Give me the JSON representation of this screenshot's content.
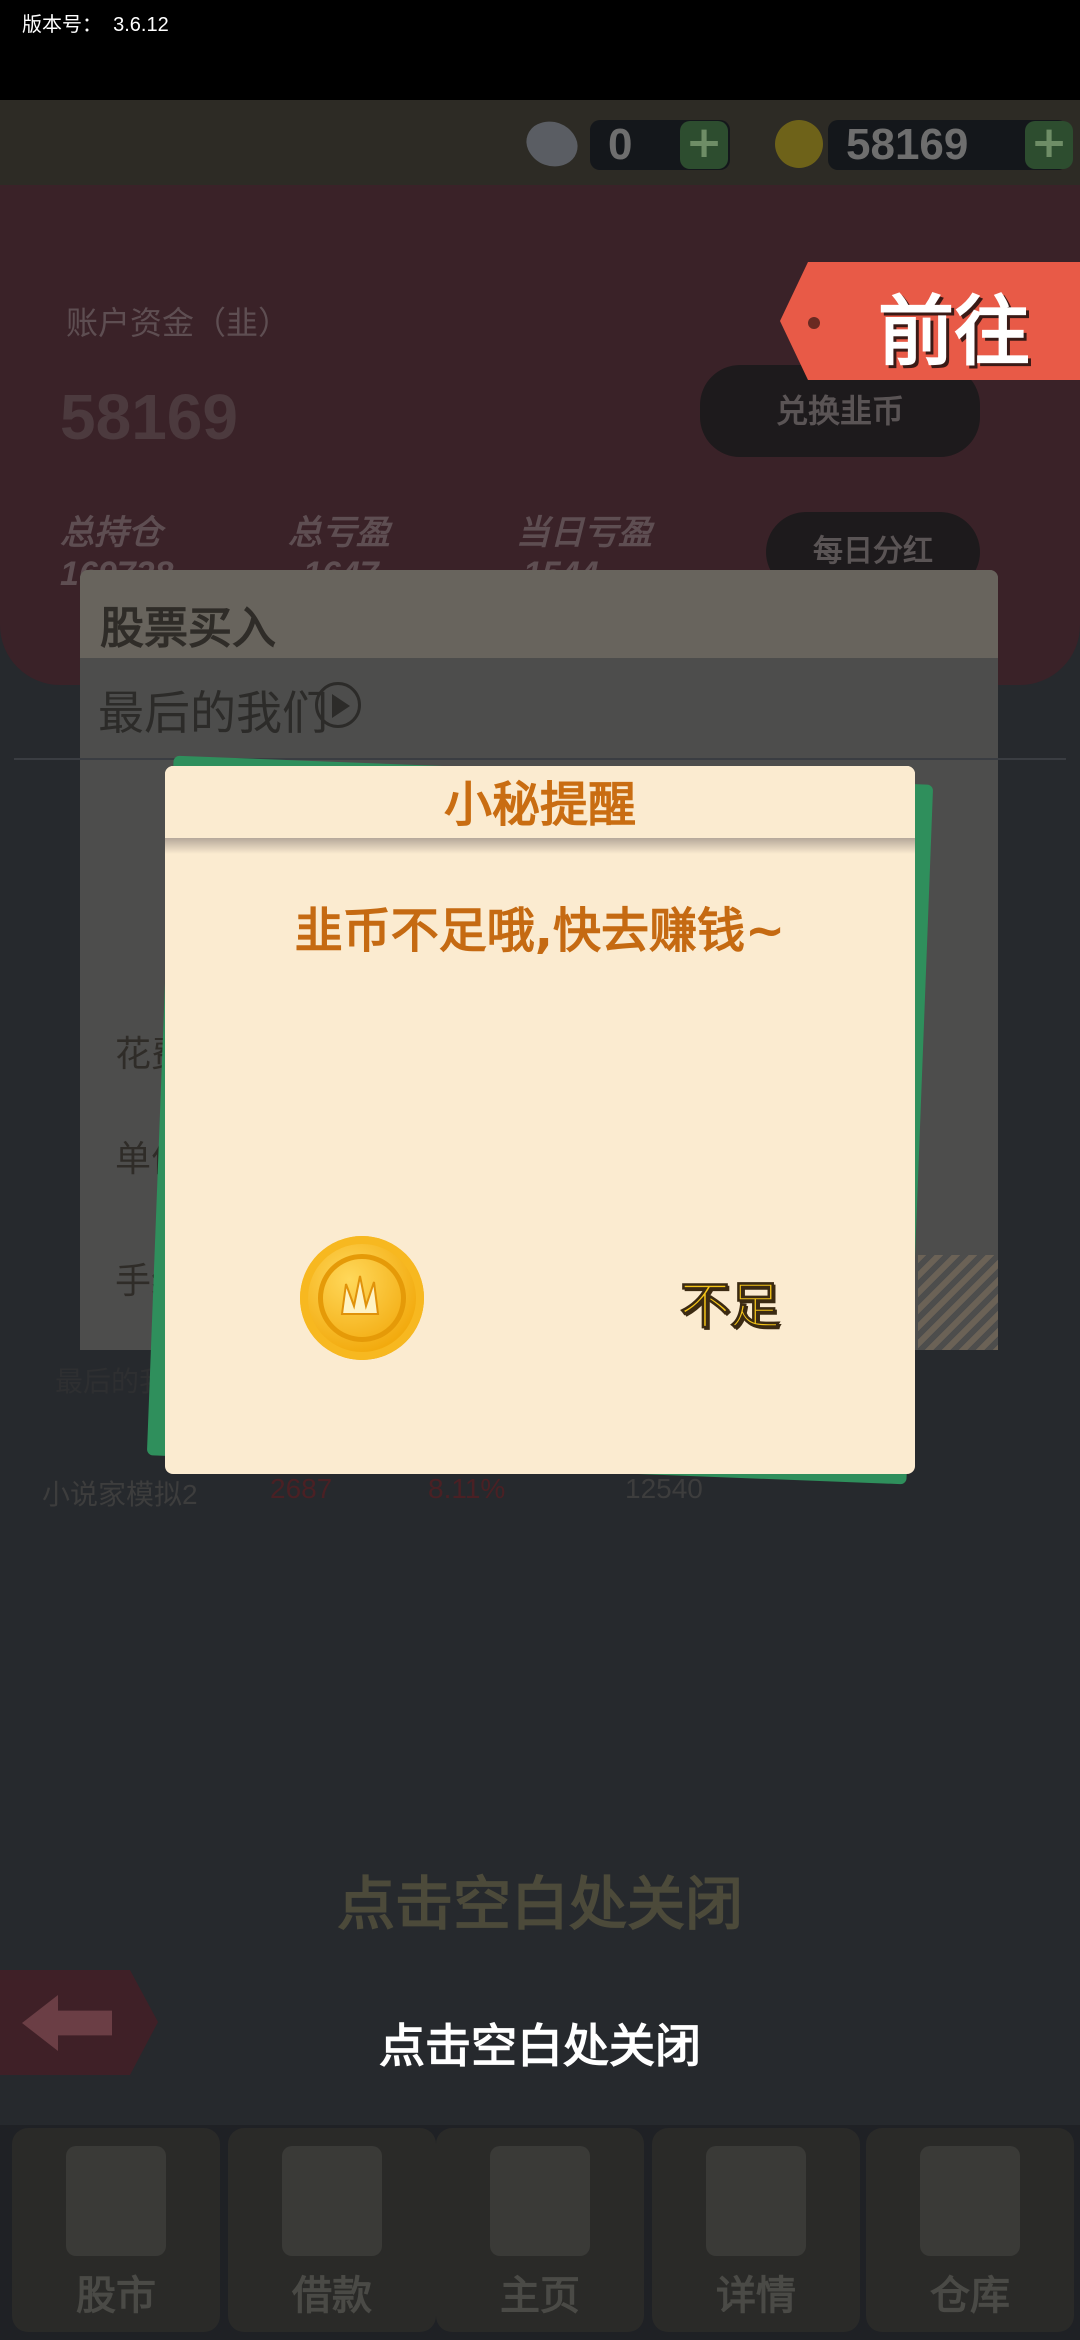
{
  "app": {
    "version_label": "版本号：",
    "version": "3.6.12"
  },
  "resources": {
    "gem_count": "0",
    "coin_count": "58169",
    "plus_symbol": "+"
  },
  "account": {
    "funds_label": "账户资金（韭）",
    "funds_value": "58169",
    "exchange_button": "兑换韭币",
    "total_position_label": "总持仓",
    "total_position_value": "169728",
    "total_pl_label": "总亏盈",
    "total_pl_value": "1647",
    "daily_pl_label": "当日亏盈",
    "daily_pl_value": "1544",
    "daily_dividend_button": "每日分红"
  },
  "goto_tag": {
    "label": "前往"
  },
  "buy_dialog": {
    "title": "股票买入",
    "stock_name": "最后的我们",
    "rows": [
      "花费",
      "单价",
      "手续费"
    ],
    "recent_label": "最后的我们",
    "list_row": {
      "name": "小说家模拟2",
      "price": "2687",
      "change": "8.11%",
      "volume": "12540"
    }
  },
  "modal": {
    "title": "小秘提醒",
    "message": "韭币不足哦,快去赚钱~",
    "status": "不足"
  },
  "hints": {
    "close_dim": "点击空白处关闭",
    "close": "点击空白处关闭"
  },
  "nav": {
    "items": [
      {
        "label": "股市"
      },
      {
        "label": "借款"
      },
      {
        "label": "主页"
      },
      {
        "label": "详情"
      },
      {
        "label": "仓库"
      }
    ]
  },
  "colors": {
    "accent": "#e85a47",
    "modal_bg": "#fbebd0",
    "title_orange": "#c96d12",
    "card_green": "#2f8f5c",
    "coin_gold": "#f2a90c"
  }
}
